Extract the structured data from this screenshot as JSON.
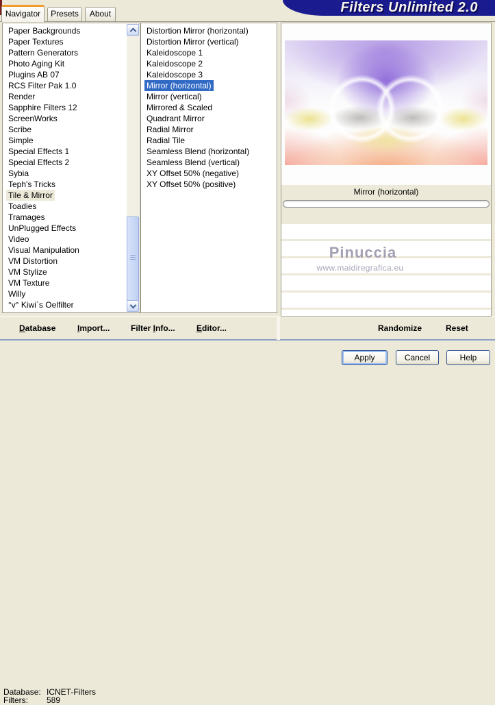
{
  "window": {
    "banner_title": "Filters Unlimited 2.0"
  },
  "tabs": {
    "navigator": "Navigator",
    "presets": "Presets",
    "about": "About"
  },
  "category_list": {
    "items": [
      {
        "label": "Paper Backgrounds",
        "selected": false
      },
      {
        "label": "Paper Textures",
        "selected": false
      },
      {
        "label": "Pattern Generators",
        "selected": false
      },
      {
        "label": "Photo Aging Kit",
        "selected": false
      },
      {
        "label": "Plugins AB 07",
        "selected": false
      },
      {
        "label": "RCS Filter Pak 1.0",
        "selected": false
      },
      {
        "label": "Render",
        "selected": false
      },
      {
        "label": "Sapphire Filters 12",
        "selected": false
      },
      {
        "label": "ScreenWorks",
        "selected": false
      },
      {
        "label": "Scribe",
        "selected": false
      },
      {
        "label": "Simple",
        "selected": false
      },
      {
        "label": "Special Effects 1",
        "selected": false
      },
      {
        "label": "Special Effects 2",
        "selected": false
      },
      {
        "label": "Sybia",
        "selected": false
      },
      {
        "label": "Teph's Tricks",
        "selected": false
      },
      {
        "label": "Tile & Mirror",
        "selected": true
      },
      {
        "label": "Toadies",
        "selected": false
      },
      {
        "label": "Tramages",
        "selected": false
      },
      {
        "label": "UnPlugged Effects",
        "selected": false
      },
      {
        "label": "Video",
        "selected": false
      },
      {
        "label": "Visual Manipulation",
        "selected": false
      },
      {
        "label": "VM Distortion",
        "selected": false
      },
      {
        "label": "VM Stylize",
        "selected": false
      },
      {
        "label": "VM Texture",
        "selected": false
      },
      {
        "label": "Willy",
        "selected": false
      },
      {
        "label": "°v° Kiwi`s Oelfilter",
        "selected": false
      }
    ]
  },
  "filter_list": {
    "items": [
      {
        "label": "Distortion Mirror (horizontal)",
        "selected": false
      },
      {
        "label": "Distortion Mirror (vertical)",
        "selected": false
      },
      {
        "label": "Kaleidoscope 1",
        "selected": false
      },
      {
        "label": "Kaleidoscope 2",
        "selected": false
      },
      {
        "label": "Kaleidoscope 3",
        "selected": false
      },
      {
        "label": "Mirror (horizontal)",
        "selected": true
      },
      {
        "label": "Mirror (vertical)",
        "selected": false
      },
      {
        "label": "Mirrored & Scaled",
        "selected": false
      },
      {
        "label": "Quadrant Mirror",
        "selected": false
      },
      {
        "label": "Radial Mirror",
        "selected": false
      },
      {
        "label": "Radial Tile",
        "selected": false
      },
      {
        "label": "Seamless Blend (horizontal)",
        "selected": false
      },
      {
        "label": "Seamless Blend (vertical)",
        "selected": false
      },
      {
        "label": "XY Offset 50% (negative)",
        "selected": false
      },
      {
        "label": "XY Offset 50% (positive)",
        "selected": false
      }
    ]
  },
  "preview": {
    "selected_filter_name": "Mirror (horizontal)",
    "watermark_title": "Pinuccia",
    "watermark_url": "www.maidiregrafica.eu"
  },
  "toolbar": {
    "database": {
      "pre": "",
      "key": "D",
      "post": "atabase"
    },
    "import": {
      "pre": "",
      "key": "I",
      "post": "mport..."
    },
    "filter_info": {
      "pre": "Filter ",
      "key": "I",
      "post": "nfo..."
    },
    "editor": {
      "pre": "",
      "key": "E",
      "post": "ditor..."
    },
    "randomize": "Randomize",
    "reset": "Reset"
  },
  "status": {
    "database_label": "Database:",
    "database_value": "ICNET-Filters",
    "filters_label": "Filters:",
    "filters_value": "589"
  },
  "buttons": {
    "apply": "Apply",
    "cancel": "Cancel",
    "help": "Help"
  },
  "colors": {
    "dialog_background": "#ece9d8",
    "selection_blue": "#316ac5",
    "inactive_selection_beige": "#ece9d8",
    "banner_navy": "#1b1b90",
    "active_tab_accent_orange": "#ee9c2e"
  }
}
